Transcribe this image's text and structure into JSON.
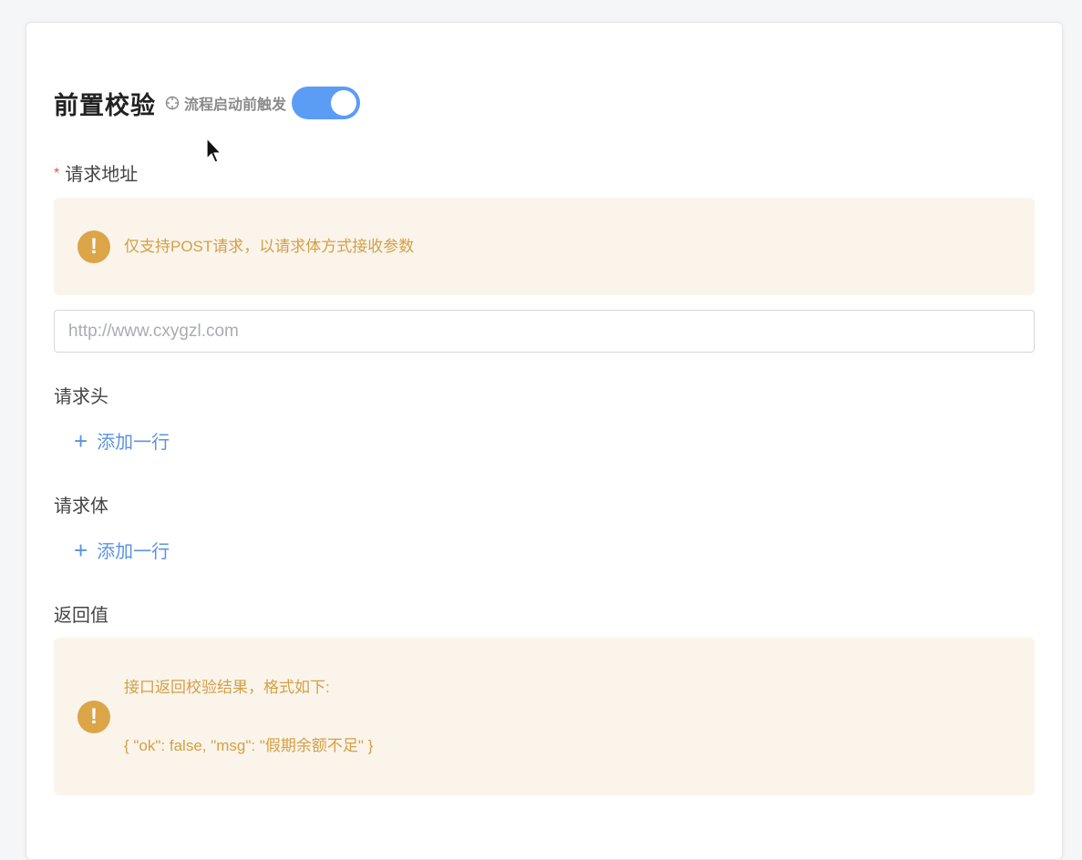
{
  "title": "前置校验",
  "hint": "流程启动前触发",
  "switch_on": true,
  "request_url": {
    "label": "请求地址",
    "required_mark": "*",
    "alert": "仅支持POST请求，以请求体方式接收参数",
    "placeholder": "http://www.cxygzl.com",
    "value": ""
  },
  "headers": {
    "label": "请求头",
    "add_label": "添加一行"
  },
  "body": {
    "label": "请求体",
    "add_label": "添加一行"
  },
  "return_value": {
    "label": "返回值",
    "alert_line1": "接口返回校验结果，格式如下:",
    "alert_line2": "{ \"ok\": false, \"msg\": \"假期余额不足\" }"
  },
  "colors": {
    "accent": "#5b9cf5",
    "link": "#5b93e0",
    "warning": "#dba548",
    "warning_bg": "#faf4eb",
    "required": "#e5534b"
  },
  "icons": {
    "hint": "crosshair-icon",
    "alert": "exclamation-icon",
    "add": "plus-icon"
  }
}
